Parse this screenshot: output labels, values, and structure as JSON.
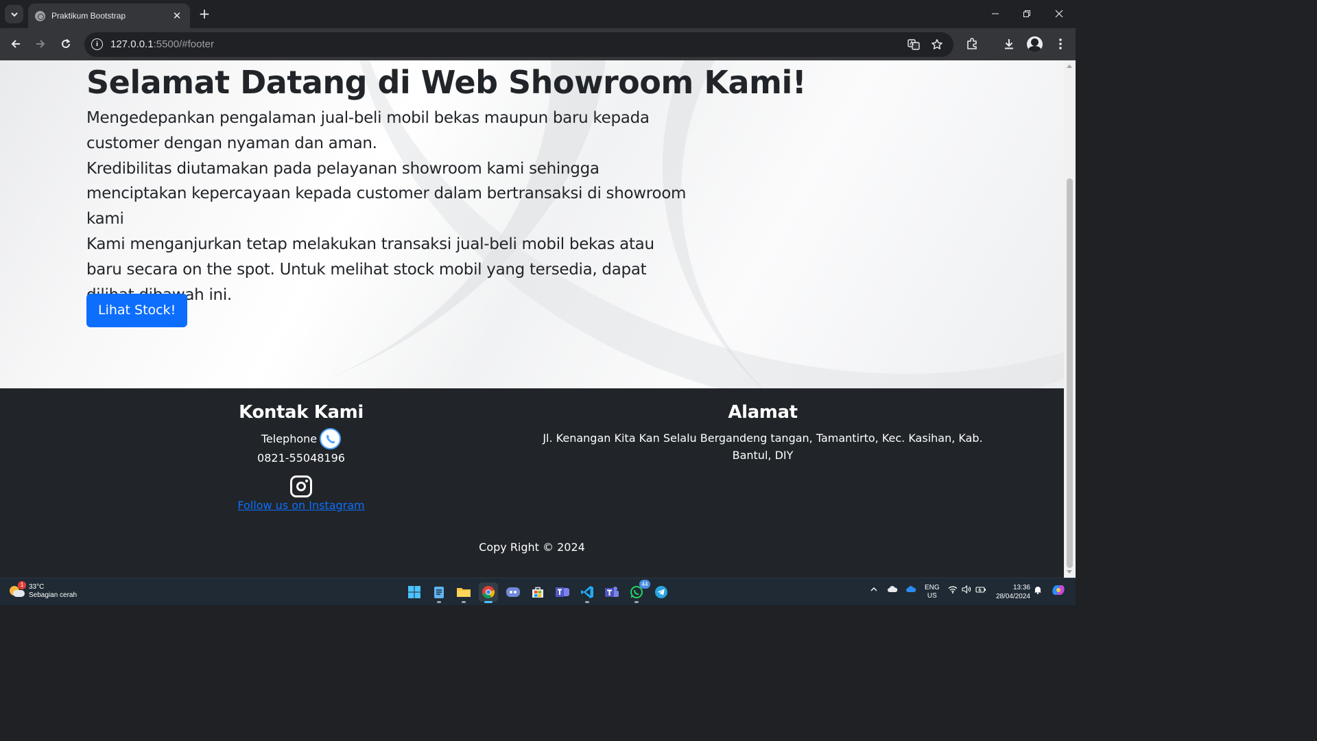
{
  "browser": {
    "tab_title": "Praktikum Bootstrap",
    "new_tab_symbol": "+",
    "url_host": "127.0.0.1",
    "url_rest": ":5500/#footer"
  },
  "hero": {
    "title": "Selamat Datang di Web Showroom Kami!",
    "paragraphs": [
      "Mengedepankan pengalaman jual-beli mobil bekas maupun baru kepada customer dengan nyaman dan aman.",
      "Kredibilitas diutamakan pada pelayanan showroom kami sehingga menciptakan kepercayaan kepada customer dalam bertransaksi di showroom kami",
      "Kami menganjurkan tetap melakukan transaksi jual-beli mobil bekas atau baru secara on the spot. Untuk melihat stock mobil yang tersedia, dapat dilihat dibawah ini."
    ],
    "button_label": "Lihat Stock!"
  },
  "footer": {
    "contact_heading": "Kontak Kami",
    "telephone_label": "Telephone",
    "telephone_number": "0821-55048196",
    "instagram_link": "Follow us on Instagram",
    "address_heading": "Alamat",
    "address_text": "Jl. Kenangan Kita Kan Selalu Bergandeng tangan, Tamantirto, Kec. Kasihan, Kab. Bantul, DIY",
    "copyright": "Copy Right © 2024"
  },
  "taskbar": {
    "weather_temp": "33°C",
    "weather_desc": "Sebagian cerah",
    "weather_badge": "1",
    "whatsapp_badge": "44",
    "lang_line1": "ENG",
    "lang_line2": "US",
    "time": "13:36",
    "date": "28/04/2024",
    "apps": [
      "windows-start",
      "notepad",
      "file-explorer",
      "chrome",
      "discord",
      "microsoft-store",
      "teams",
      "vscode",
      "teams-classic",
      "whatsapp",
      "telegram"
    ]
  },
  "colors": {
    "primary_button": "#0d6efd",
    "footer_bg": "#212529",
    "link": "#0d6efd",
    "chrome_dark": "#202124",
    "taskbar_bg": "#1f2a34"
  }
}
